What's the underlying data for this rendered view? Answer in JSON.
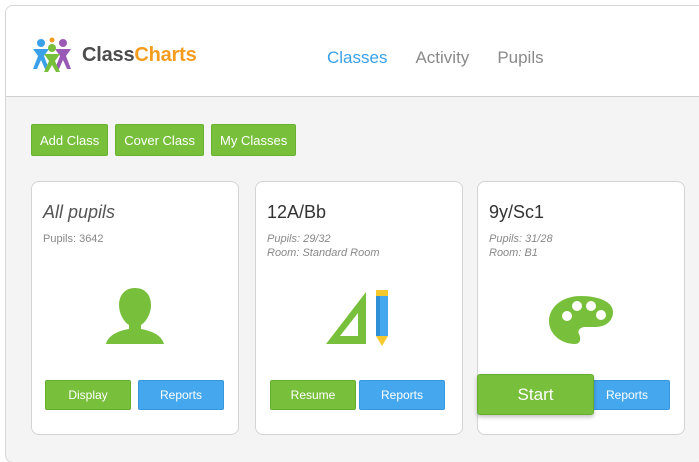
{
  "brand": {
    "name_part1": "Class",
    "name_part2": "Charts"
  },
  "nav": {
    "items": [
      {
        "label": "Classes",
        "active": true
      },
      {
        "label": "Activity",
        "active": false
      },
      {
        "label": "Pupils",
        "active": false
      }
    ]
  },
  "toolbar": {
    "add_class": "Add Class",
    "cover_class": "Cover Class",
    "my_classes": "My Classes"
  },
  "cards": [
    {
      "title": "All pupils",
      "meta1": "Pupils: 3642",
      "icon": "person-silhouette-icon",
      "primary_label": "Display",
      "secondary_label": "Reports"
    },
    {
      "title": "12A/Bb",
      "meta1": "Pupils: 29/32",
      "meta2": "Room: Standard Room",
      "icon": "set-square-pencil-icon",
      "primary_label": "Resume",
      "secondary_label": "Reports"
    },
    {
      "title": "9y/Sc1",
      "meta1": "Pupils: 31/28",
      "meta2": "Room: B1",
      "icon": "paint-palette-icon",
      "primary_label": "Start",
      "secondary_label": "Reports"
    }
  ],
  "colors": {
    "green": "#78c03c",
    "blue": "#45a8ef",
    "accent": "#3aa0e8",
    "brand_orange": "#f39c1e"
  }
}
